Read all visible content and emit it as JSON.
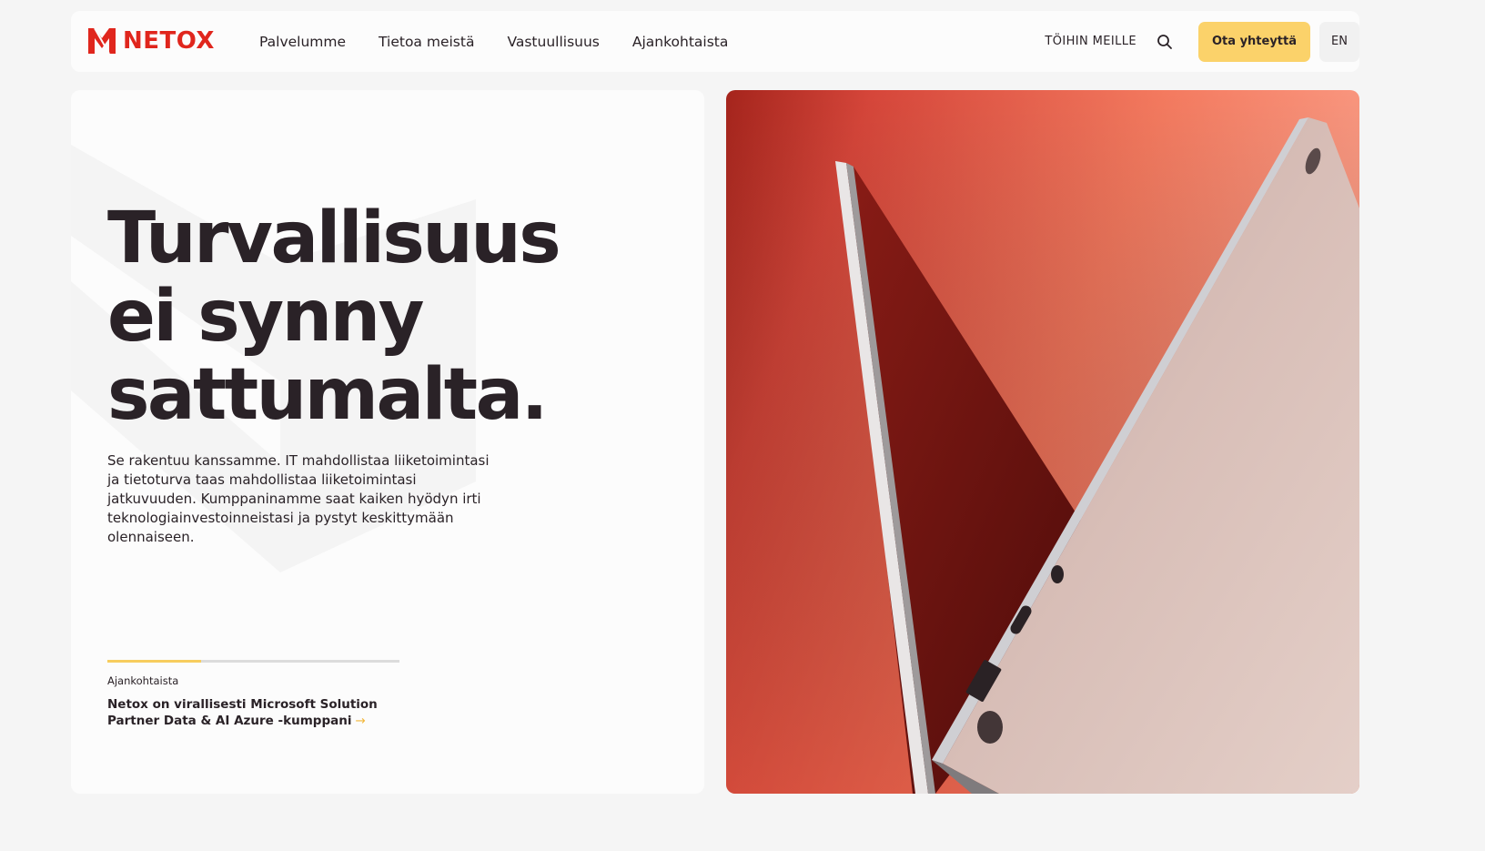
{
  "brand": {
    "name": "NETOX",
    "color": "#e0261d"
  },
  "nav": {
    "items": [
      {
        "label": "Palvelumme"
      },
      {
        "label": "Tietoa meistä"
      },
      {
        "label": "Vastuullisuus"
      },
      {
        "label": "Ajankohtaista"
      }
    ],
    "careers_label": "TÖIHIN MEILLE",
    "search_icon": "search-icon",
    "cta_label": "Ota yhteyttä",
    "cta_color": "#fbd26a",
    "lang_label": "EN"
  },
  "hero": {
    "headline": [
      "Turvallisuus",
      "ei synny",
      "sattumalta."
    ],
    "intro": "Se rakentuu kanssamme. IT mahdollistaa liiketoimintasi ja tietoturva taas mahdollistaa liiketoimintasi jatkuvuuden. Kumppaninamme saat kaiken hyödyn irti teknologiainvestoinneistasi ja pystyt keskittymään olennaiseen.",
    "news": {
      "label": "Ajankohtaista",
      "title": "Netox on virallisesti Microsoft Solution Partner Data & AI Azure -kumppani",
      "arrow": "→",
      "progress_fraction": 0.32
    },
    "image_subject": "laptop-on-orange-background"
  }
}
